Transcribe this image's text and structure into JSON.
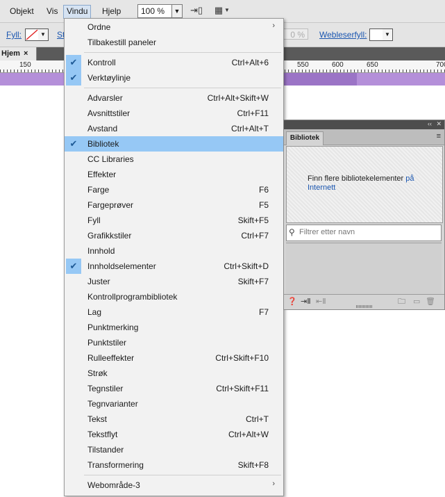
{
  "menubar": {
    "items": [
      {
        "label": "Objekt"
      },
      {
        "label": "Vis"
      },
      {
        "label": "Vindu"
      },
      {
        "label": "Hjelp"
      }
    ],
    "zoom": "100 %"
  },
  "control_bar": {
    "fill_label": "Fyll:",
    "stroke_label_partial": "St",
    "opacity_partial": "0 %",
    "browser_fill_label": "Webleserfyll:"
  },
  "document": {
    "tab_label": "Hjem",
    "tab_close": "×",
    "ruler_numbers": [
      "150",
      "550",
      "600",
      "650",
      "700"
    ]
  },
  "window_menu": {
    "items": [
      {
        "label": "Ordne",
        "shortcut": "",
        "submenu": true
      },
      {
        "label": "Tilbakestill paneler",
        "shortcut": ""
      },
      {
        "label": "Kontroll",
        "shortcut": "Ctrl+Alt+6",
        "checked": true
      },
      {
        "label": "Verktøylinje",
        "shortcut": "",
        "checked": true
      },
      {
        "label": "Advarsler",
        "shortcut": "Ctrl+Alt+Skift+W"
      },
      {
        "label": "Avsnittstiler",
        "shortcut": "Ctrl+F11"
      },
      {
        "label": "Avstand",
        "shortcut": "Ctrl+Alt+T"
      },
      {
        "label": "Bibliotek",
        "shortcut": "",
        "checked": true,
        "highlighted": true
      },
      {
        "label": "CC Libraries",
        "shortcut": ""
      },
      {
        "label": "Effekter",
        "shortcut": ""
      },
      {
        "label": "Farge",
        "shortcut": "F6"
      },
      {
        "label": "Fargeprøver",
        "shortcut": "F5"
      },
      {
        "label": "Fyll",
        "shortcut": "Skift+F5"
      },
      {
        "label": "Grafikkstiler",
        "shortcut": "Ctrl+F7"
      },
      {
        "label": "Innhold",
        "shortcut": ""
      },
      {
        "label": "Innholdselementer",
        "shortcut": "Ctrl+Skift+D",
        "checked": true
      },
      {
        "label": "Juster",
        "shortcut": "Skift+F7"
      },
      {
        "label": "Kontrollprogrambibliotek",
        "shortcut": ""
      },
      {
        "label": "Lag",
        "shortcut": "F7"
      },
      {
        "label": "Punktmerking",
        "shortcut": ""
      },
      {
        "label": "Punktstiler",
        "shortcut": ""
      },
      {
        "label": "Rulleeffekter",
        "shortcut": "Ctrl+Skift+F10"
      },
      {
        "label": "Strøk",
        "shortcut": ""
      },
      {
        "label": "Tegnstiler",
        "shortcut": "Ctrl+Skift+F11"
      },
      {
        "label": "Tegnvarianter",
        "shortcut": ""
      },
      {
        "label": "Tekst",
        "shortcut": "Ctrl+T"
      },
      {
        "label": "Tekstflyt",
        "shortcut": "Ctrl+Alt+W"
      },
      {
        "label": "Tilstander",
        "shortcut": ""
      },
      {
        "label": "Transformering",
        "shortcut": "Skift+F8"
      },
      {
        "label": "Webområde-3",
        "shortcut": "",
        "submenu": true
      }
    ]
  },
  "library_panel": {
    "tab_label": "Bibliotek",
    "message": "Finn flere bibliotekelementer",
    "link_text": "på Internett",
    "filter_placeholder": "Filtrer etter navn"
  },
  "colors": {
    "highlight": "#96c8f5",
    "link": "#1a56b0",
    "purple_band": "#b48fd9"
  }
}
